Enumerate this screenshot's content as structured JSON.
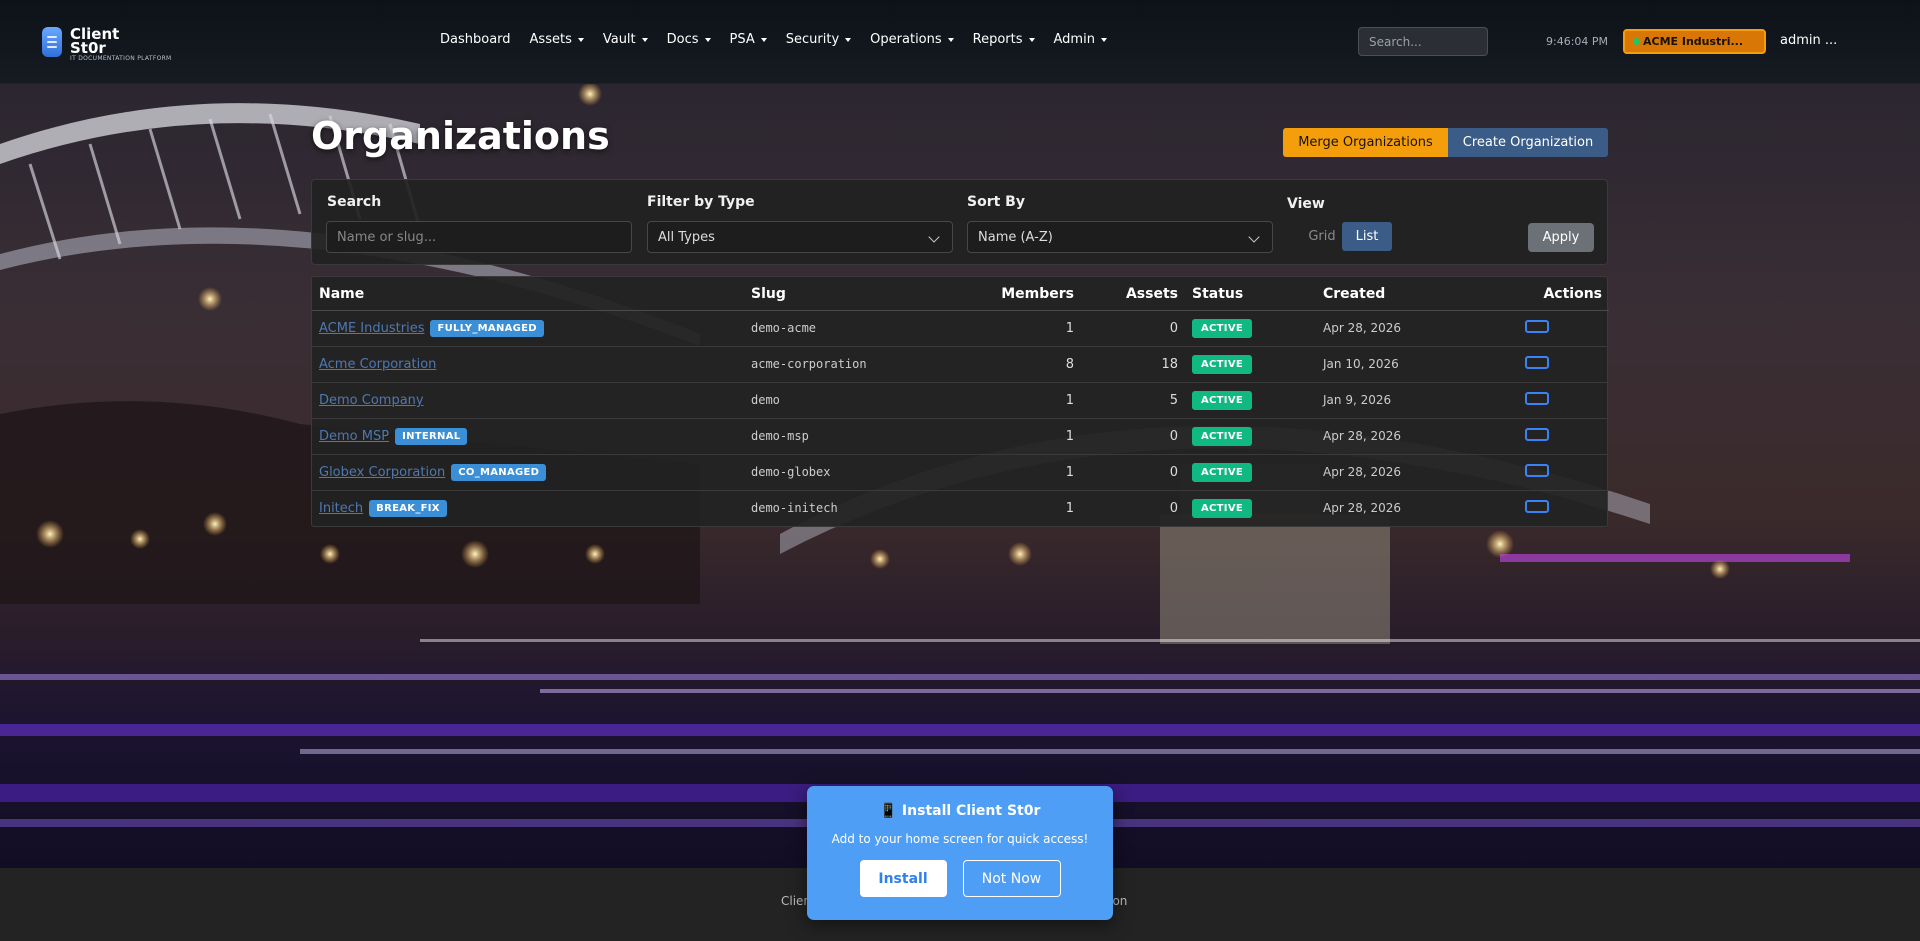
{
  "brand": {
    "name": "Client St0r",
    "tagline": "IT DOCUMENTATION PLATFORM"
  },
  "nav": {
    "items": [
      {
        "label": "Dashboard",
        "dropdown": false
      },
      {
        "label": "Assets",
        "dropdown": true
      },
      {
        "label": "Vault",
        "dropdown": true
      },
      {
        "label": "Docs",
        "dropdown": true
      },
      {
        "label": "PSA",
        "dropdown": true
      },
      {
        "label": "Security",
        "dropdown": true
      },
      {
        "label": "Operations",
        "dropdown": true
      },
      {
        "label": "Reports",
        "dropdown": true
      },
      {
        "label": "Admin",
        "dropdown": true
      }
    ],
    "search_placeholder": "Search...",
    "clock": "9:46:04 PM",
    "current_org": "ACME Industri...",
    "user": "admin ..."
  },
  "page": {
    "title": "Organizations",
    "merge_label": "Merge Organizations",
    "create_label": "Create Organization"
  },
  "filters": {
    "search_label": "Search",
    "search_placeholder": "Name or slug...",
    "type_label": "Filter by Type",
    "type_value": "All Types",
    "sort_label": "Sort By",
    "sort_value": "Name (A-Z)",
    "view_label": "View",
    "view_grid": "Grid",
    "view_list": "List",
    "apply_label": "Apply"
  },
  "table": {
    "headers": {
      "name": "Name",
      "slug": "Slug",
      "members": "Members",
      "assets": "Assets",
      "status": "Status",
      "created": "Created",
      "actions": "Actions"
    },
    "rows": [
      {
        "name": "ACME Industries",
        "badge": "FULLY_MANAGED",
        "slug": "demo-acme",
        "members": "1",
        "assets": "0",
        "status": "ACTIVE",
        "created": "Apr 28, 2026"
      },
      {
        "name": "Acme Corporation",
        "badge": "",
        "slug": "acme-corporation",
        "members": "8",
        "assets": "18",
        "status": "ACTIVE",
        "created": "Jan 10, 2026"
      },
      {
        "name": "Demo Company",
        "badge": "",
        "slug": "demo",
        "members": "1",
        "assets": "5",
        "status": "ACTIVE",
        "created": "Jan 9, 2026"
      },
      {
        "name": "Demo MSP",
        "badge": "INTERNAL",
        "slug": "demo-msp",
        "members": "1",
        "assets": "0",
        "status": "ACTIVE",
        "created": "Apr 28, 2026"
      },
      {
        "name": "Globex Corporation",
        "badge": "CO_MANAGED",
        "slug": "demo-globex",
        "members": "1",
        "assets": "0",
        "status": "ACTIVE",
        "created": "Apr 28, 2026"
      },
      {
        "name": "Initech",
        "badge": "BREAK_FIX",
        "slug": "demo-initech",
        "members": "1",
        "assets": "0",
        "status": "ACTIVE",
        "created": "Apr 28, 2026"
      }
    ]
  },
  "footer": {
    "text": "Clien",
    "text_end": "ation"
  },
  "install_prompt": {
    "title": "📱 Install Client St0r",
    "message": "Add to your home screen for quick access!",
    "install_label": "Install",
    "dismiss_label": "Not Now"
  },
  "colors": {
    "accent": "#f59e0b",
    "primary": "#3a5c86",
    "badge": "#3b8fd6",
    "status_active": "#10b981",
    "install_bg": "#4f9ef5"
  }
}
